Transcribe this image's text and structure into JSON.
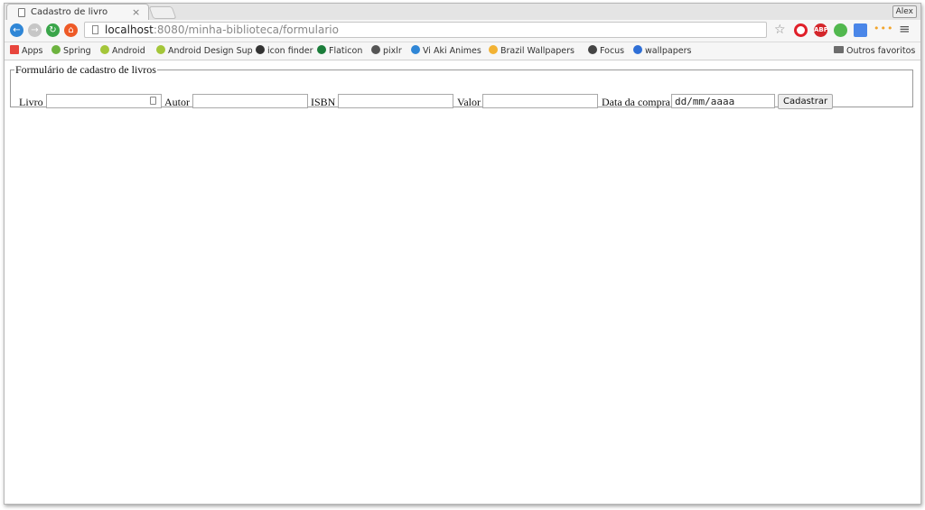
{
  "browser": {
    "tab": {
      "title": "Cadastro de livro",
      "close": "×"
    },
    "profile": "Alex",
    "nav": {
      "back": "←",
      "forward": "→",
      "reload": "↻",
      "home": "⌂"
    },
    "url": {
      "host": "localhost",
      "rest": ":8080/minha-biblioteca/formulario"
    },
    "star": "☆",
    "extensions": {
      "abp": "ABP",
      "dots": "•••"
    },
    "menu": "≡",
    "bookmarks": [
      {
        "label": "Apps",
        "color": "#e8453c"
      },
      {
        "label": "Spring",
        "color": "#6db33f"
      },
      {
        "label": "Android",
        "color": "#a4c639"
      },
      {
        "label": "Android Design Sup",
        "color": "#a4c639"
      },
      {
        "label": "icon finder",
        "color": "#333333"
      },
      {
        "label": "Flaticon",
        "color": "#1b7d3a"
      },
      {
        "label": "pixlr",
        "color": "#555555"
      },
      {
        "label": "Vi Aki Animes",
        "color": "#2f86d6"
      },
      {
        "label": "Brazil Wallpapers",
        "color": "#f2b233"
      },
      {
        "label": "Focus",
        "color": "#444444"
      },
      {
        "label": "wallpapers",
        "color": "#2f6fd6"
      }
    ],
    "other_bookmarks": "Outros favoritos"
  },
  "form": {
    "legend": "Formulário de cadastro de livros",
    "livro_label": "Livro",
    "autor_label": "Autor",
    "isbn_label": "ISBN",
    "valor_label": "Valor",
    "data_label": "Data da compra",
    "data_placeholder": "dd/mm/aaaa",
    "submit_label": "Cadastrar"
  }
}
